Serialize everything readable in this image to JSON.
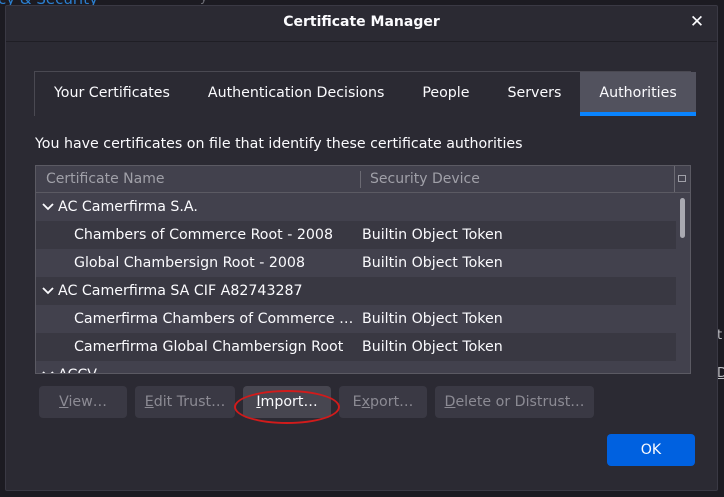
{
  "background": {
    "crumb": "cy & Security",
    "crumb_dim": "y",
    "edge_t": "t",
    "edge_d": "D"
  },
  "dialog": {
    "title": "Certificate Manager",
    "close_label": "✕"
  },
  "tabs": [
    {
      "label": "Your Certificates",
      "active": false
    },
    {
      "label": "Authentication Decisions",
      "active": false
    },
    {
      "label": "People",
      "active": false
    },
    {
      "label": "Servers",
      "active": false
    },
    {
      "label": "Authorities",
      "active": true
    }
  ],
  "description": "You have certificates on file that identify these certificate authorities",
  "tree": {
    "columns": {
      "name": "Certificate Name",
      "device": "Security Device"
    },
    "groups": [
      {
        "name": "AC Camerfirma S.A.",
        "certs": [
          {
            "name": "Chambers of Commerce Root - 2008",
            "device": "Builtin Object Token"
          },
          {
            "name": "Global Chambersign Root - 2008",
            "device": "Builtin Object Token"
          }
        ]
      },
      {
        "name": "AC Camerfirma SA CIF A82743287",
        "certs": [
          {
            "name": "Camerfirma Chambers of Commerce Root",
            "device": "Builtin Object Token"
          },
          {
            "name": "Camerfirma Global Chambersign Root",
            "device": "Builtin Object Token"
          }
        ]
      },
      {
        "name": "ACCV",
        "certs": []
      }
    ]
  },
  "buttons": {
    "view": {
      "pre": "",
      "ul": "V",
      "post": "iew…"
    },
    "edit_trust": {
      "pre": "",
      "ul": "E",
      "post": "dit Trust…"
    },
    "import": {
      "pre": "",
      "ul": "I",
      "post": "mport…"
    },
    "export": {
      "pre": "E",
      "ul": "x",
      "post": "port…"
    },
    "delete": {
      "pre": "",
      "ul": "D",
      "post": "elete or Distrust…"
    },
    "ok": "OK"
  },
  "colors": {
    "accent": "#0a84ff",
    "ok_button": "#0061e0",
    "annotation": "#d11b1b"
  }
}
